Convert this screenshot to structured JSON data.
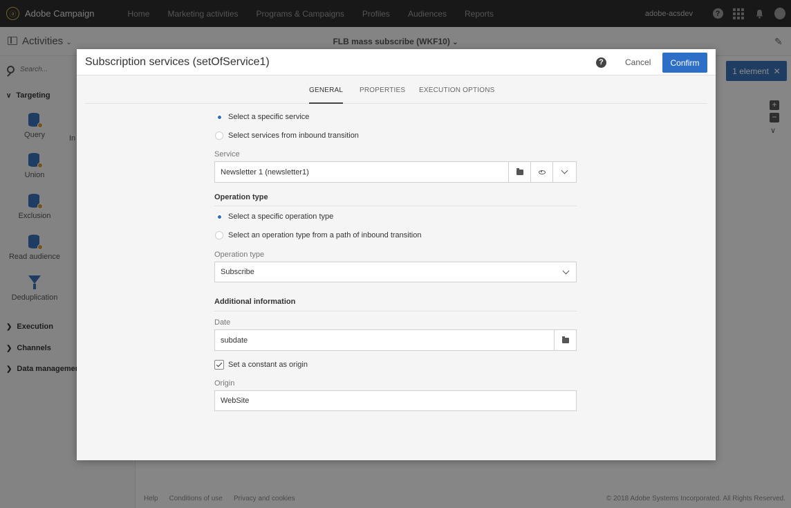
{
  "app": {
    "brand": "Adobe Campaign",
    "logo_glyph": "ⓐ",
    "nav": [
      "Home",
      "Marketing activities",
      "Programs & Campaigns",
      "Profiles",
      "Audiences",
      "Reports"
    ],
    "user": "adobe-acsdev",
    "help_glyph": "?"
  },
  "subheader": {
    "activities_label": "Activities",
    "workflow_title": "FLB mass subscribe (WKF10)"
  },
  "leftpanel": {
    "search_placeholder": "Search...",
    "categories": {
      "targeting": "Targeting",
      "execution": "Execution",
      "channels": "Channels",
      "data_management": "Data management ("
    },
    "items": {
      "query": "Query",
      "union": "Union",
      "exclusion": "Exclusion",
      "read_audience": "Read audience",
      "deduplication": "Deduplication",
      "partial": "In"
    }
  },
  "canvas": {
    "selection_badge": "1 element",
    "zoom_in": "+",
    "zoom_out": "−",
    "footer_links": [
      "Help",
      "Conditions of use",
      "Privacy and cookies"
    ],
    "copyright": "© 2018 Adobe Systems Incorporated. All Rights Reserved."
  },
  "modal": {
    "title": "Subscription services (setOfService1)",
    "help": "?",
    "cancel": "Cancel",
    "confirm": "Confirm",
    "tabs": [
      "GENERAL",
      "PROPERTIES",
      "EXECUTION OPTIONS"
    ],
    "active_tab": "GENERAL",
    "service_mode": {
      "option_specific": "Select a specific service",
      "option_inbound": "Select services from inbound transition",
      "selected": "option_specific"
    },
    "service": {
      "label": "Service",
      "value": "Newsletter 1 (newsletter1)"
    },
    "operation_section": "Operation type",
    "operation_mode": {
      "option_specific": "Select a specific operation type",
      "option_path": "Select an operation type from a path of inbound transition",
      "selected": "option_specific"
    },
    "operation_type": {
      "label": "Operation type",
      "value": "Subscribe"
    },
    "additional_section": "Additional information",
    "date": {
      "label": "Date",
      "value": "subdate"
    },
    "constant_origin": {
      "label": "Set a constant as origin",
      "checked": true
    },
    "origin": {
      "label": "Origin",
      "value": "WebSite"
    }
  },
  "colors": {
    "topbar": "#2c2c2c",
    "primary_button": "#2d6fc7",
    "selection_badge": "#3a6fb4"
  }
}
